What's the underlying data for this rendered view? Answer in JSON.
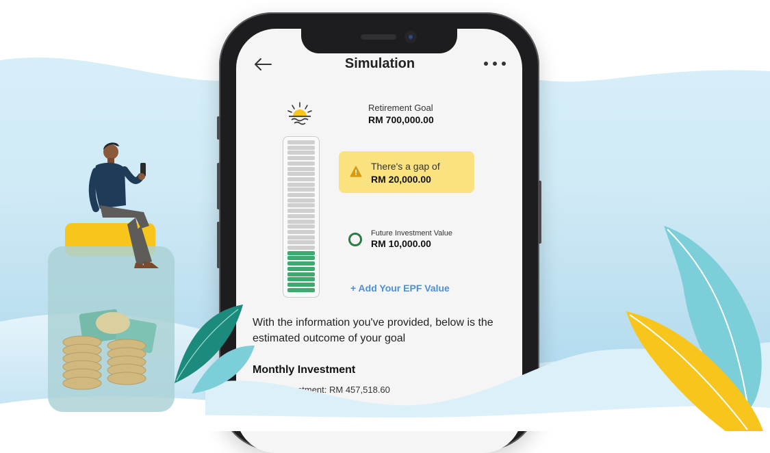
{
  "header": {
    "back_icon": "arrow-left-icon",
    "title": "Simulation",
    "more_icon": "more-horizontal-icon"
  },
  "goal": {
    "icon": "sunrise-icon",
    "label": "Retirement Goal",
    "value": "RM 700,000.00"
  },
  "gap_alert": {
    "icon": "warning-icon",
    "line1": "There's a gap of",
    "amount": "RM 20,000.00"
  },
  "future_value": {
    "label": "Future Investment Value",
    "value": "RM 10,000.00"
  },
  "meter": {
    "total_segments": 29,
    "filled_segments": 8,
    "filled_fraction": 0.28
  },
  "epf_link": "+ Add Your EPF Value",
  "info_text": "With the information you've provided, below is the estimated outcome of your goal",
  "monthly": {
    "title": "Monthly Investment",
    "future_investment": "Future Investment: RM 457,518.60"
  },
  "colors": {
    "gap_card": "#f9e27f",
    "meter_filled": "#3faa6f",
    "meter_empty": "#cfcfcf",
    "link": "#4d8fd6",
    "status_ring": "#2e7a45"
  }
}
